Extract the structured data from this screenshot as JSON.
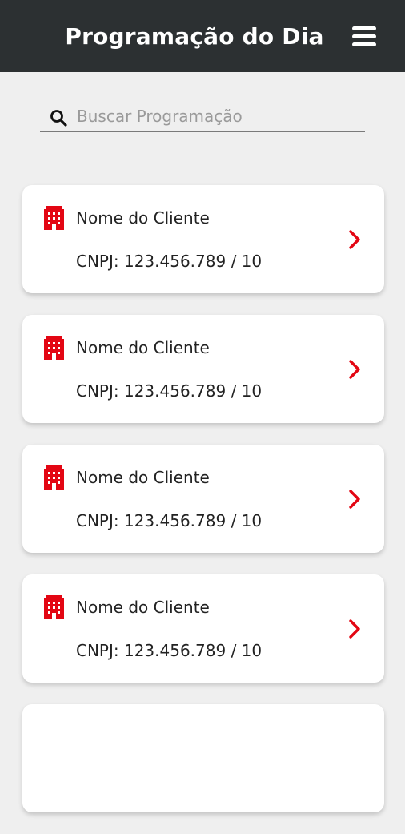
{
  "header": {
    "title": "Programação do Dia",
    "menu_icon": "hamburger-menu-icon"
  },
  "search": {
    "placeholder": "Buscar Programação",
    "value": "",
    "icon": "search-icon"
  },
  "colors": {
    "header_bg": "#2c3032",
    "accent": "#e30613",
    "page_bg": "#efefef"
  },
  "clients": [
    {
      "name": "Nome do Cliente",
      "cnpj": "CNPJ: 123.456.789 / 10",
      "icon": "building-icon"
    },
    {
      "name": "Nome do Cliente",
      "cnpj": "CNPJ: 123.456.789 / 10",
      "icon": "building-icon"
    },
    {
      "name": "Nome do Cliente",
      "cnpj": "CNPJ: 123.456.789 / 10",
      "icon": "building-icon"
    },
    {
      "name": "Nome do Cliente",
      "cnpj": "CNPJ: 123.456.789 / 10",
      "icon": "building-icon"
    },
    {
      "name": "",
      "cnpj": "",
      "icon": ""
    }
  ]
}
